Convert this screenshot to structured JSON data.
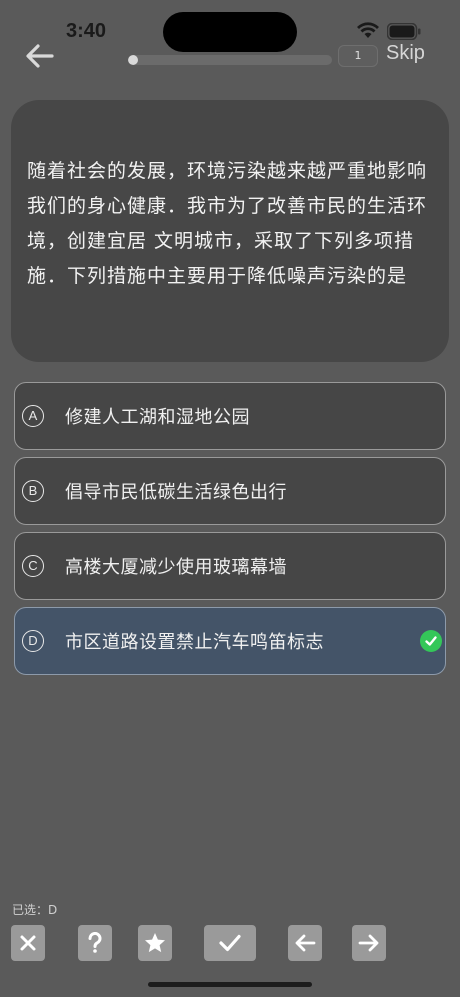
{
  "status": {
    "time": "3:40"
  },
  "nav": {
    "progress": 0.05,
    "counter": "1",
    "skip": "Skip"
  },
  "question": {
    "text": "随着社会的发展，环境污染越来越严重地影响我们的身心健康．我市为了改善市民的生活环境，创建宜居 文明城市，采取了下列多项措施．下列措施中主要用于降低噪声污染的是"
  },
  "options": [
    {
      "letter": "A",
      "text": "修建人工湖和湿地公园"
    },
    {
      "letter": "B",
      "text": "倡导市民低碳生活绿色出行"
    },
    {
      "letter": "C",
      "text": "高楼大厦减少使用玻璃幕墙"
    },
    {
      "letter": "D",
      "text": "市区道路设置禁止汽车鸣笛标志"
    }
  ],
  "selected_option": "D",
  "footer": {
    "selected_label": "已选：D"
  },
  "toolbar": [
    "close-icon",
    "help-icon",
    "star-icon",
    "check-icon",
    "arrow-left-icon",
    "arrow-right-icon"
  ],
  "colors": {
    "selected_bg": "#445468",
    "check_green": "#34c759"
  }
}
